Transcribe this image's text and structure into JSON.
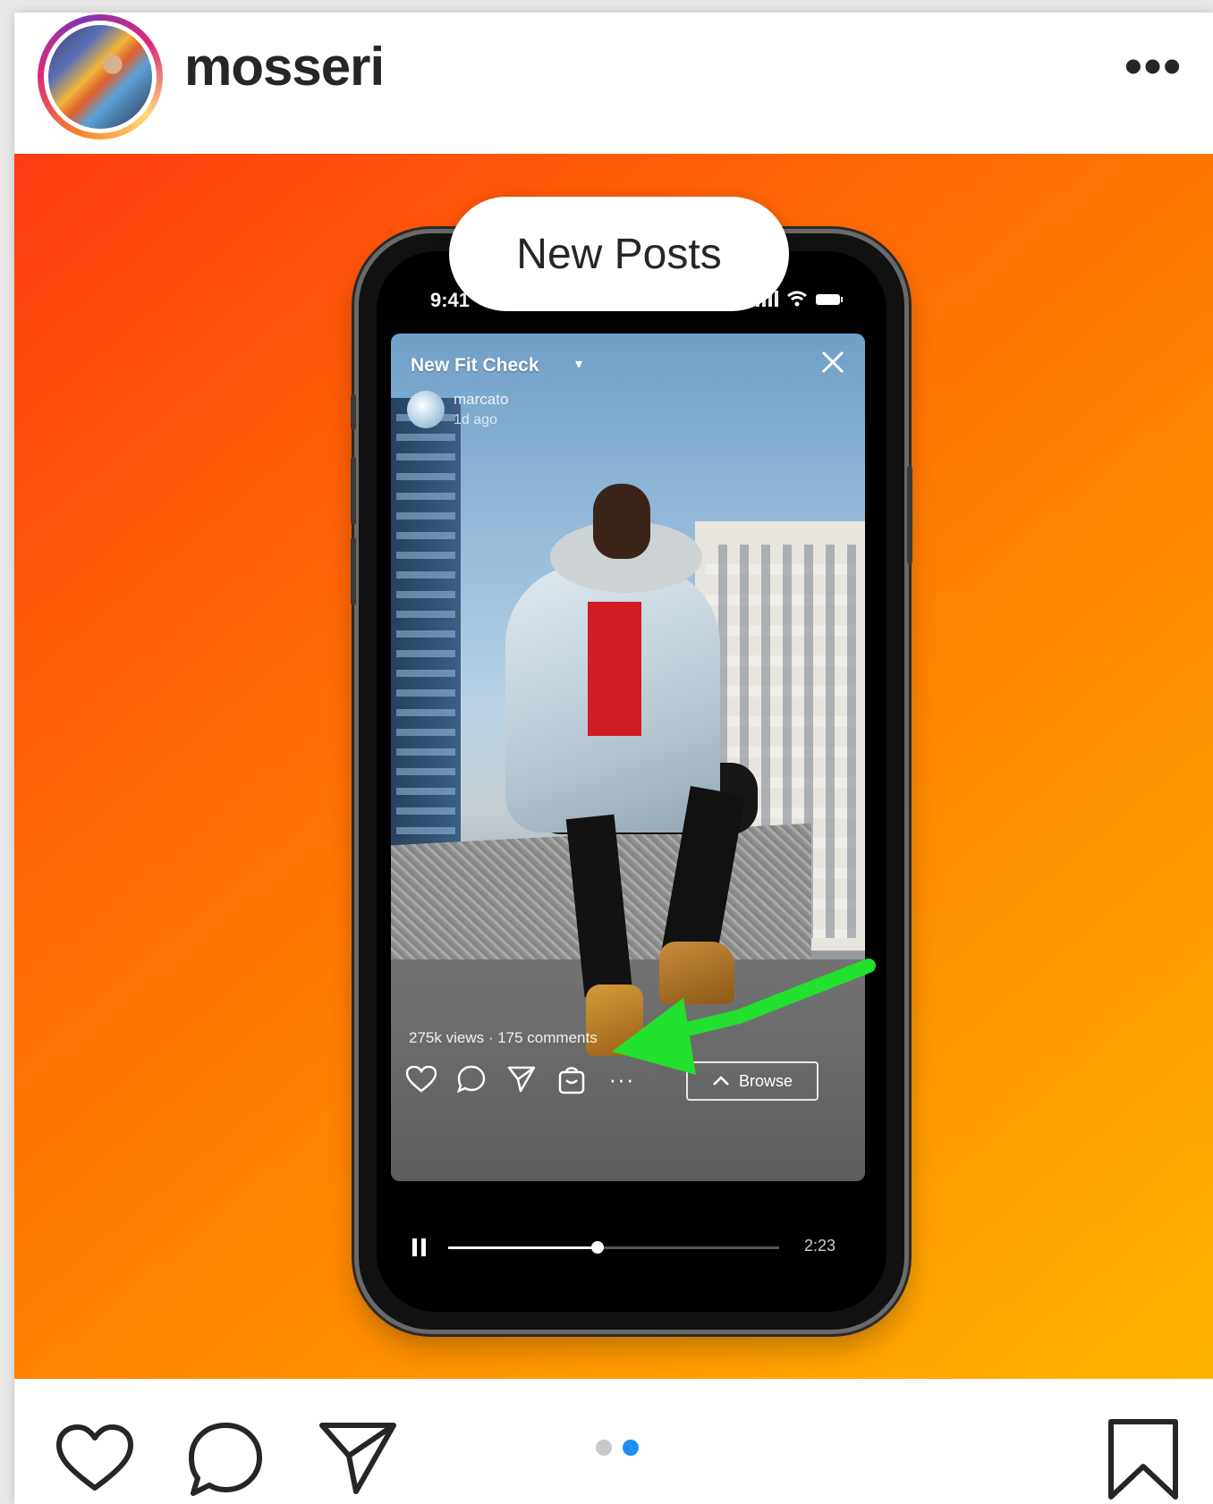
{
  "post": {
    "username": "mosseri",
    "more_icon": "more-horizontal-icon"
  },
  "overlay": {
    "new_posts_label": "New Posts"
  },
  "phone": {
    "status_time": "9:41",
    "story": {
      "title": "New Fit Check",
      "user": "marcato",
      "time_ago": "1d ago",
      "stats": "275k views · 175 comments",
      "browse_label": "Browse"
    },
    "player": {
      "progress": 0.45,
      "duration": "2:23"
    }
  },
  "carousel": {
    "count": 2,
    "active_index": 1
  },
  "colors": {
    "annotation_arrow": "#22e02e",
    "carousel_active": "#1f8ef1",
    "carousel_inactive": "#c8c8c8",
    "media_gradient_start": "#ff3c12",
    "media_gradient_end": "#ffb300"
  }
}
